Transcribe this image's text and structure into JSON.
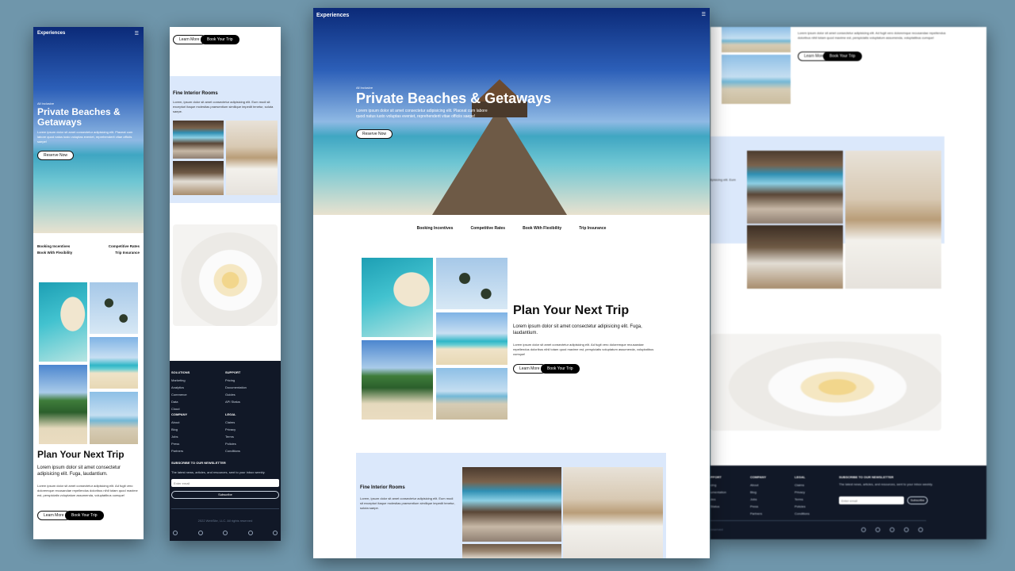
{
  "brand": "Experiences",
  "hero": {
    "eyebrow": "All Inclusive",
    "title": "Private Beaches & Getaways",
    "body": "Lorem ipsum dolor sit amet consectetur adipisicing elit. Placeat cum labore quod natus iusto voluptas eveniet, reprehenderit vitae officiis saepe!",
    "cta": "Reserve Now"
  },
  "features": [
    "Booking Incentives",
    "Competitive Rates",
    "Book With Flexibility",
    "Trip Insurance"
  ],
  "plan": {
    "title": "Plan Your Next Trip",
    "lead": "Lorem ipsum dolor sit amet consectetur adipisicing elit. Fuga, laudantium.",
    "body": "Lorem ipsum dolor sit amet consectetur adipisicing elit. Ad fugit vero doloremque recusandae repellendus doloribus nihil totam quod maxime est, perspiciatis voluptatum assumenda, voluptatibus cumque!",
    "learn": "Learn More",
    "book": "Book Your Trip"
  },
  "rooms": {
    "title": "Fine Interior Rooms",
    "body": "Lorem, ipsum dolor sit amet consectetur adipisicing elit. Eum modi sit excepturi itaque molestias praesentium similique impedit tenetur, soluta saepe."
  },
  "footer": {
    "solutions": {
      "title": "SOLUTIONS",
      "items": [
        "Marketing",
        "Analytics",
        "Commerce",
        "Data",
        "Cloud"
      ]
    },
    "support": {
      "title": "SUPPORT",
      "items": [
        "Pricing",
        "Documentation",
        "Guides",
        "API Status"
      ]
    },
    "company": {
      "title": "COMPANY",
      "items": [
        "About",
        "Blog",
        "Jobs",
        "Press",
        "Partners"
      ]
    },
    "legal": {
      "title": "LEGAL",
      "items": [
        "Claims",
        "Privacy",
        "Terms",
        "Policies",
        "Conditions"
      ]
    },
    "newsletter": {
      "title": "SUBSCRIBE TO OUR NEWSLETTER",
      "body": "The latest news, articles, and resources, sent to your inbox weekly.",
      "placeholder": "Enter email",
      "button": "Subscribe"
    },
    "copyright": "2022 WebSite, LLC. All rights reserved"
  }
}
